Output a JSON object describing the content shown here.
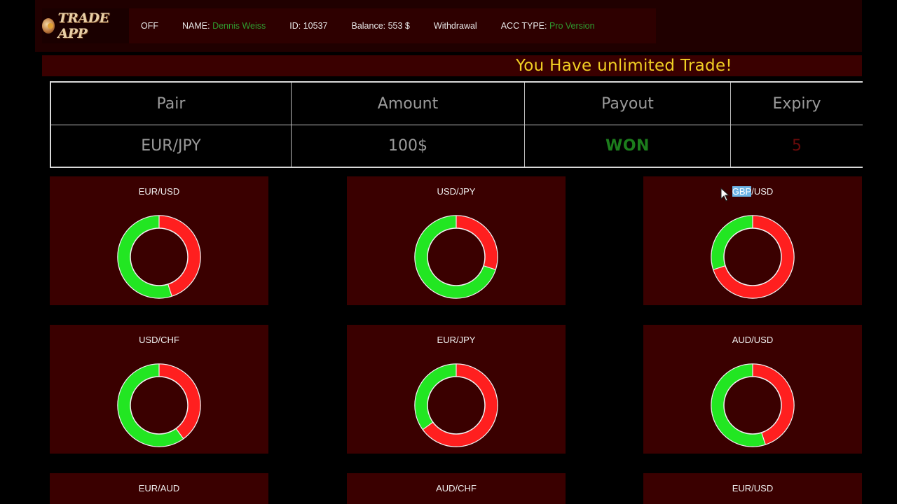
{
  "header": {
    "logo_text": "TRADE APP",
    "status": "OFF",
    "name_label": "NAME:",
    "name_value": "Dennis Weiss",
    "id": "ID: 10537",
    "balance": "Balance: 553 $",
    "withdrawal": "Withdrawal",
    "acc_type_label": "ACC TYPE:",
    "acc_type_value": "Pro Version"
  },
  "banner": {
    "text": "You Have unlimited Trade!"
  },
  "trade_table": {
    "headers": [
      "Pair",
      "Amount",
      "Payout",
      "Expiry"
    ],
    "row": {
      "pair": "EUR/JPY",
      "amount": "100$",
      "payout": "WON",
      "expiry": "5"
    }
  },
  "colors": {
    "bull": "#22e622",
    "bear": "#ff1f1f",
    "card_bg": "#3a0000",
    "banner_text": "#f2d024",
    "won": "#1c7d1c"
  },
  "pairs": [
    {
      "label": "EUR/USD",
      "red_fraction": 0.45
    },
    {
      "label": "USD/JPY",
      "red_fraction": 0.3
    },
    {
      "label": "GBP/USD",
      "label_highlighted": "GBP",
      "label_rest": "/USD",
      "red_fraction": 0.7
    },
    {
      "label": "USD/CHF",
      "red_fraction": 0.4
    },
    {
      "label": "EUR/JPY",
      "red_fraction": 0.65
    },
    {
      "label": "AUD/USD",
      "red_fraction": 0.45
    },
    {
      "label": "EUR/AUD"
    },
    {
      "label": "AUD/CHF"
    },
    {
      "label": "EUR/USD"
    }
  ]
}
